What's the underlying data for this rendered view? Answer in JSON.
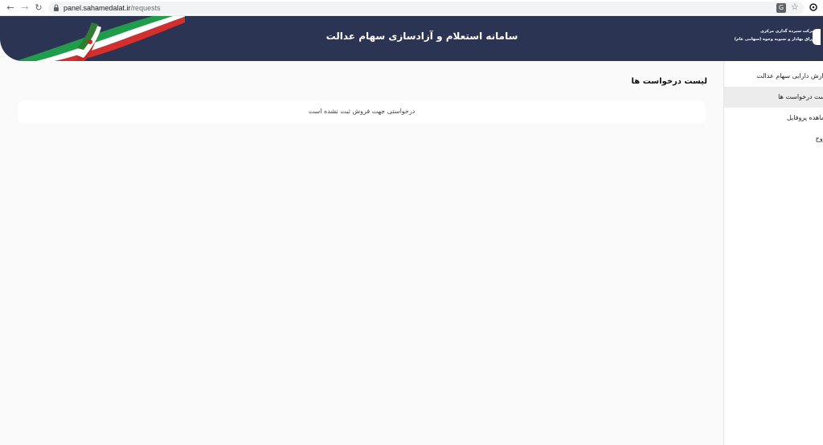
{
  "browser": {
    "url_host": "panel.sahamedalat.ir",
    "url_path": "/requests"
  },
  "header": {
    "title": "سامانه استعلام و آزادسازی سهام عدالت",
    "logo_line1": "شرکت سپرده گذاری مرکزی",
    "logo_line2": "اوراق بهادار و تسویه وجوه (سهامی عام)"
  },
  "sidebar": {
    "items": [
      {
        "label": "گزارش دارایی سهام عدالت"
      },
      {
        "label": "لیست درخواست ها"
      },
      {
        "label": "مشاهده پروفایل"
      },
      {
        "label": "خروج"
      }
    ]
  },
  "main": {
    "title": "لیست درخواست ها",
    "empty_message": "درخواستی جهت فروش ثبت نشده است"
  },
  "colors": {
    "header_bg": "#2b3553",
    "active_item_bg": "#ececec",
    "page_bg": "#fafafa"
  }
}
